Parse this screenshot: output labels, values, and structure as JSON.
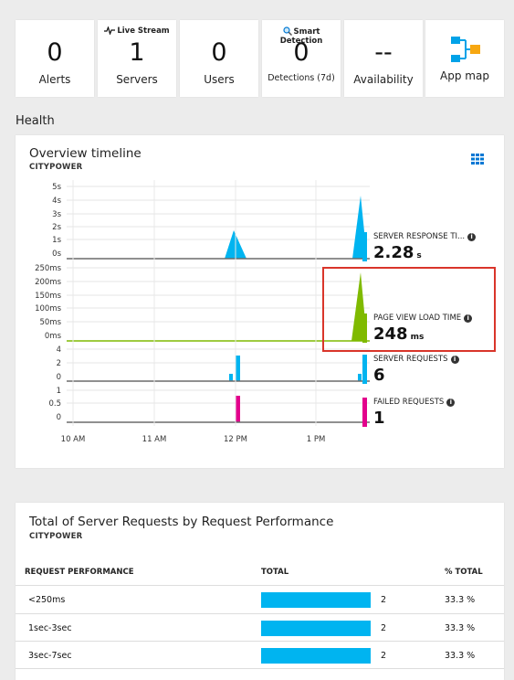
{
  "tiles": [
    {
      "top": "",
      "value": "0",
      "label": "Alerts"
    },
    {
      "top": "Live Stream",
      "top_icon": "pulse-icon",
      "value": "1",
      "label": "Servers"
    },
    {
      "top": "",
      "value": "0",
      "label": "Users"
    },
    {
      "top": "Smart Detection",
      "top_icon": "magnifier-icon",
      "value": "0",
      "label": "Detections (7d)"
    },
    {
      "top": "",
      "value": "--",
      "label": "Availability"
    },
    {
      "top": "",
      "icon": "app-map-icon",
      "label": "App map"
    }
  ],
  "health_label": "Health",
  "overview": {
    "title": "Overview timeline",
    "subtitle": "CITYPOWER",
    "grid_icon": "grid-icon",
    "x_ticks": [
      "10 AM",
      "11 AM",
      "12 PM",
      "1 PM"
    ],
    "panels": [
      {
        "y_ticks": [
          "5s",
          "4s",
          "3s",
          "2s",
          "1s",
          "0s"
        ]
      },
      {
        "y_ticks": [
          "250ms",
          "200ms",
          "150ms",
          "100ms",
          "50ms",
          "0ms"
        ]
      },
      {
        "y_ticks": [
          "4",
          "2",
          "0"
        ]
      },
      {
        "y_ticks": [
          "1",
          "0.5",
          "0"
        ]
      }
    ],
    "metrics": [
      {
        "name": "SERVER RESPONSE TI...",
        "value": "2.28",
        "unit": "s",
        "color": "#00b4f0"
      },
      {
        "name": "PAGE VIEW LOAD TIME",
        "value": "248",
        "unit": "ms",
        "color": "#7fba00"
      },
      {
        "name": "SERVER REQUESTS",
        "value": "6",
        "unit": "",
        "color": "#00b4f0"
      },
      {
        "name": "FAILED REQUESTS",
        "value": "1",
        "unit": "",
        "color": "#e3008c"
      }
    ]
  },
  "perf": {
    "title": "Total of Server Requests by Request Performance",
    "subtitle": "CITYPOWER",
    "headers": [
      "REQUEST PERFORMANCE",
      "TOTAL",
      "% TOTAL"
    ],
    "rows": [
      {
        "name": "<250ms",
        "total": "2",
        "pct": "33.3 %",
        "fraction": 1.0
      },
      {
        "name": "1sec-3sec",
        "total": "2",
        "pct": "33.3 %",
        "fraction": 1.0
      },
      {
        "name": "3sec-7sec",
        "total": "2",
        "pct": "33.3 %",
        "fraction": 1.0
      }
    ]
  },
  "colors": {
    "accent": "#00b4f0",
    "green": "#7fba00",
    "magenta": "#e3008c",
    "highlight": "#d9352a"
  }
}
